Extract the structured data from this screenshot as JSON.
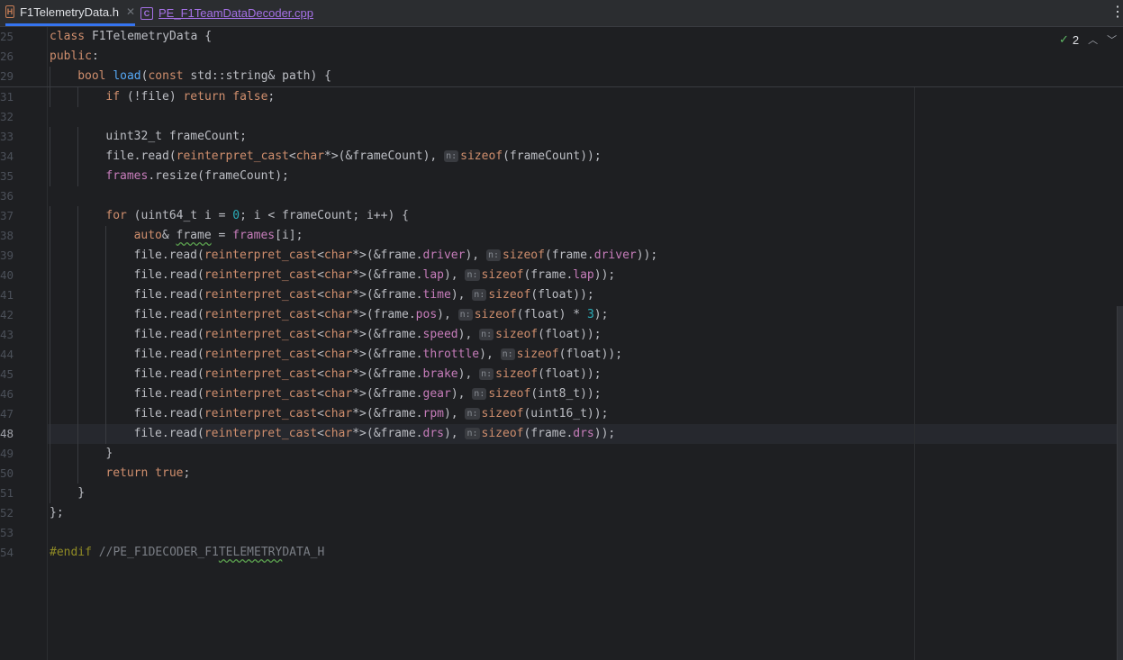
{
  "tabs": [
    {
      "label": "F1TelemetryData.h",
      "icon": "h-file-icon",
      "active": true
    },
    {
      "label": "PE_F1TeamDataDecoder.cpp",
      "icon": "cpp-file-icon",
      "active": false
    }
  ],
  "inspections": {
    "count": "2"
  },
  "lines": [
    {
      "n": "25",
      "code": "class F1TelemetryData {"
    },
    {
      "n": "26",
      "code": "public:"
    },
    {
      "n": "29",
      "code": "    bool load(const std::string& path) {"
    },
    {
      "n": "31",
      "code": "        if (!file) return false;"
    },
    {
      "n": "32",
      "code": ""
    },
    {
      "n": "33",
      "code": "        uint32_t frameCount;"
    },
    {
      "n": "34",
      "code": "        file.read(reinterpret_cast<char*>(&frameCount), n: sizeof(frameCount));"
    },
    {
      "n": "35",
      "code": "        frames.resize(frameCount);"
    },
    {
      "n": "36",
      "code": ""
    },
    {
      "n": "37",
      "code": "        for (uint64_t i = 0; i < frameCount; i++) {"
    },
    {
      "n": "38",
      "code": "            auto& frame = frames[i];"
    },
    {
      "n": "39",
      "code": "            file.read(reinterpret_cast<char*>(&frame.driver), n: sizeof(frame.driver));"
    },
    {
      "n": "40",
      "code": "            file.read(reinterpret_cast<char*>(&frame.lap), n: sizeof(frame.lap));"
    },
    {
      "n": "41",
      "code": "            file.read(reinterpret_cast<char*>(&frame.time), n: sizeof(float));"
    },
    {
      "n": "42",
      "code": "            file.read(reinterpret_cast<char*>(frame.pos), n: sizeof(float) * 3);"
    },
    {
      "n": "43",
      "code": "            file.read(reinterpret_cast<char*>(&frame.speed), n: sizeof(float));"
    },
    {
      "n": "44",
      "code": "            file.read(reinterpret_cast<char*>(&frame.throttle), n: sizeof(float));"
    },
    {
      "n": "45",
      "code": "            file.read(reinterpret_cast<char*>(&frame.brake), n: sizeof(float));"
    },
    {
      "n": "46",
      "code": "            file.read(reinterpret_cast<char*>(&frame.gear), n: sizeof(int8_t));"
    },
    {
      "n": "47",
      "code": "            file.read(reinterpret_cast<char*>(&frame.rpm), n: sizeof(uint16_t));"
    },
    {
      "n": "48",
      "code": "            file.read(reinterpret_cast<char*>(&frame.drs), n: sizeof(frame.drs));"
    },
    {
      "n": "49",
      "code": "        }"
    },
    {
      "n": "50",
      "code": "        return true;"
    },
    {
      "n": "51",
      "code": "    }"
    },
    {
      "n": "52",
      "code": "};"
    },
    {
      "n": "53",
      "code": ""
    },
    {
      "n": "54",
      "code": "#endif //PE_F1DECODER_F1TELEMETRYDATA_H"
    }
  ],
  "current_line": "48",
  "colors": {
    "keyword": "#cf8e6d",
    "function": "#56a8f5",
    "field": "#c77dbb",
    "number": "#2aacb8",
    "active_tab_underline": "#3574f0"
  }
}
